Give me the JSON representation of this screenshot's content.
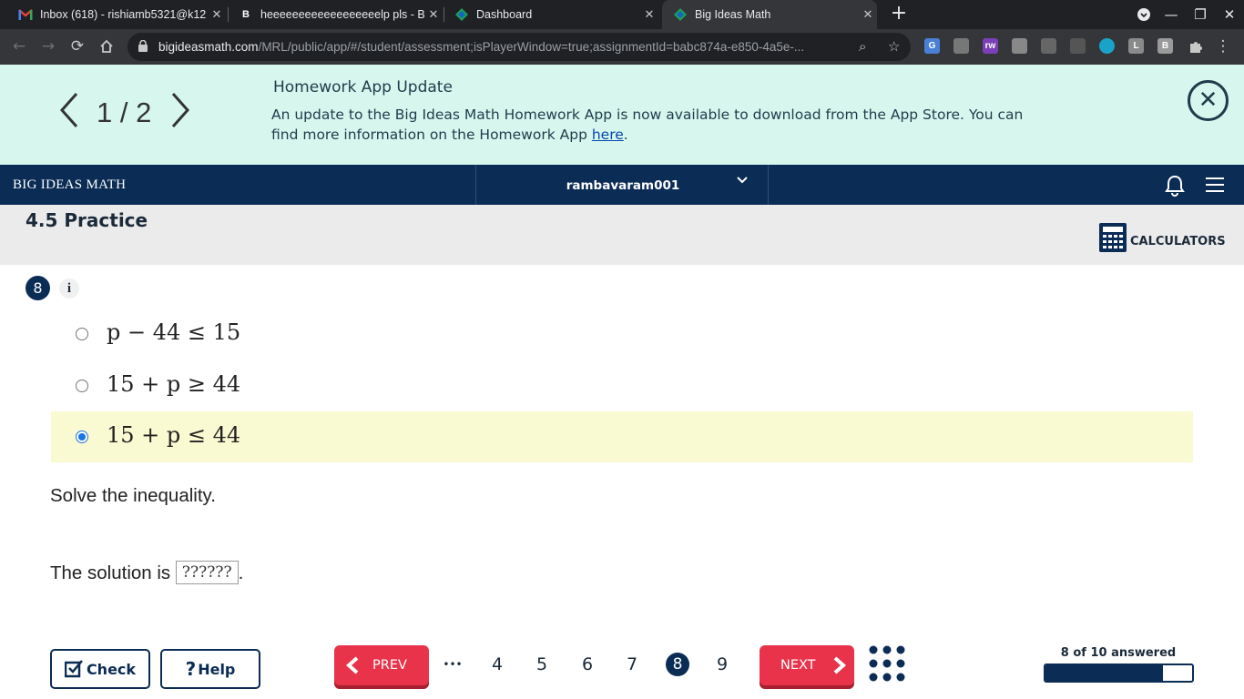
{
  "browser": {
    "tabs": [
      {
        "title": "Inbox (618) - rishiamb5321@k12",
        "icon": "gmail-icon"
      },
      {
        "title": "heeeeeeeeeeeeeeeeeelp pls - Bra",
        "icon": "brainly-icon"
      },
      {
        "title": "Dashboard",
        "icon": "big-ideas-icon"
      },
      {
        "title": "Big Ideas Math",
        "icon": "big-ideas-icon"
      }
    ],
    "url_host": "bigideasmath.com",
    "url_path": "/MRL/public/app/#/student/assessment;isPlayerWindow=true;assignmentId=babc874a-e850-4a5e-...",
    "extensions": [
      "G",
      "",
      "rw",
      "",
      "",
      "",
      "",
      "L",
      "B"
    ]
  },
  "banner": {
    "pager": "1 / 2",
    "title": "Homework App Update",
    "body": "An update to the Big Ideas Math Homework App is now available to download from the App Store. You can find more information on the Homework App ",
    "link": "here",
    "end": "."
  },
  "navbar": {
    "brand": "BIG IDEAS MATH",
    "user": "rambavaram001"
  },
  "section": {
    "title": "4.5 Practice",
    "calculators": "CALCULATORS"
  },
  "question": {
    "number": "8",
    "info": "i",
    "options": [
      {
        "text": "p − 44 ≤ 15",
        "selected": false
      },
      {
        "text": "15 + p ≥ 44",
        "selected": false
      },
      {
        "text": "15 + p ≤ 44",
        "selected": true
      }
    ],
    "prompt": "Solve the inequality.",
    "answer_prefix": "The solution is",
    "answer_value": "??????",
    "answer_suffix": "."
  },
  "footer": {
    "check": "Check",
    "help": "Help",
    "prev": "PREV",
    "next": "NEXT",
    "ellipsis": "•••",
    "pages": [
      "4",
      "5",
      "6",
      "7",
      "8",
      "9"
    ],
    "current_page": "8",
    "progress_text": "8 of 10 answered",
    "answered": 8,
    "total": 10
  },
  "colors": {
    "navy": "#0b2c55",
    "banner_bg": "#d7f7ee",
    "accent_red": "#e8334a",
    "selected_bg": "#fafad2"
  }
}
